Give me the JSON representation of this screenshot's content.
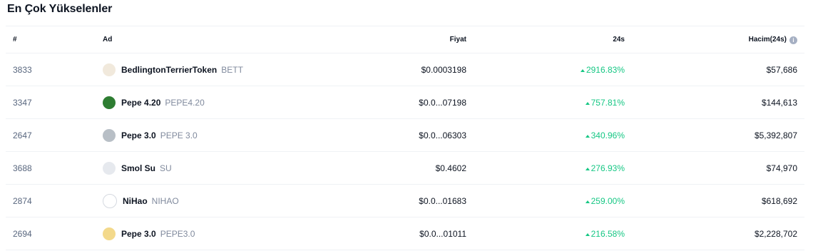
{
  "section": {
    "title": "En Çok Yükselenler"
  },
  "table": {
    "headers": {
      "rank": "#",
      "name": "Ad",
      "price": "Fiyat",
      "change": "24s",
      "volume": "Hacim(24s)"
    },
    "info_icon": "info-icon",
    "up_color": "#16c784",
    "rows": [
      {
        "rank": "3833",
        "name": "BedlingtonTerrierToken",
        "symbol": "BETT",
        "price": "$0.0003198",
        "change": "2916.83%",
        "volume": "$57,686",
        "icon": "dog-face-icon",
        "icon_color": "#f1e9dc"
      },
      {
        "rank": "3347",
        "name": "Pepe 4.20",
        "symbol": "PEPE4.20",
        "price": "$0.0...07198",
        "change": "757.81%",
        "volume": "$144,613",
        "icon": "green-frog-icon",
        "icon_color": "#2e7d32"
      },
      {
        "rank": "2647",
        "name": "Pepe 3.0",
        "symbol": "PEPE 3.0",
        "price": "$0.0...06303",
        "change": "340.96%",
        "volume": "$5,392,807",
        "icon": "gray-frog-icon",
        "icon_color": "#b8bfc6"
      },
      {
        "rank": "3688",
        "name": "Smol Su",
        "symbol": "SU",
        "price": "$0.4602",
        "change": "276.93%",
        "volume": "$74,970",
        "icon": "cartoon-face-icon",
        "icon_color": "#e6e9ee"
      },
      {
        "rank": "2874",
        "name": "NiHao",
        "symbol": "NIHAO",
        "price": "$0.0...01683",
        "change": "259.00%",
        "volume": "$618,692",
        "icon": "cat-figure-icon",
        "icon_color": "#ffffff"
      },
      {
        "rank": "2694",
        "name": "Pepe 3.0",
        "symbol": "PEPE3.0",
        "price": "$0.0...01011",
        "change": "216.58%",
        "volume": "$2,228,702",
        "icon": "frog-black-hat-icon",
        "icon_color": "#f3d98b"
      }
    ]
  }
}
